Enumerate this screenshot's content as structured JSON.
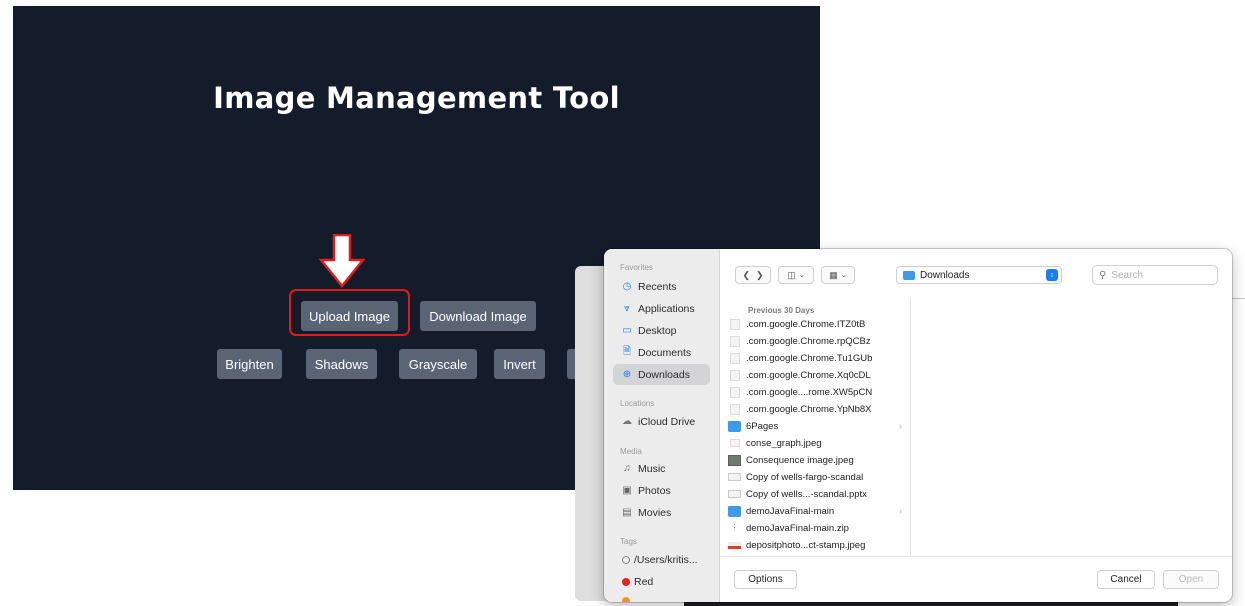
{
  "app": {
    "title": "Image Management Tool",
    "buttons": {
      "upload": "Upload Image",
      "download": "Download Image",
      "brighten": "Brighten",
      "shadows": "Shadows",
      "grayscale": "Grayscale",
      "invert": "Invert"
    }
  },
  "dialog": {
    "sidebar": {
      "favorites_header": "Favorites",
      "favorites": [
        "Recents",
        "Applications",
        "Desktop",
        "Documents",
        "Downloads"
      ],
      "selected": "Downloads",
      "locations_header": "Locations",
      "locations": [
        "iCloud Drive"
      ],
      "media_header": "Media",
      "media": [
        "Music",
        "Photos",
        "Movies"
      ],
      "tags_header": "Tags",
      "tags": [
        "/Users/kritis...",
        "Red"
      ]
    },
    "toolbar": {
      "location": "Downloads",
      "search_placeholder": "Search"
    },
    "list_header": "Previous 30 Days",
    "files": [
      ".com.google.Chrome.ITZ0tB",
      ".com.google.Chrome.rpQCBz",
      ".com.google.Chrome.Tu1GUb",
      ".com.google.Chrome.Xq0cDL",
      ".com.google....rome.XW5pCN",
      ".com.google.Chrome.YpNb8X",
      "6Pages",
      "conse_graph.jpeg",
      "Consequence image.jpeg",
      "Copy of wells-fargo-scandal",
      "Copy of wells...-scandal.pptx",
      "demoJavaFinal-main",
      "demoJavaFinal-main.zip",
      "depositphoto...ct-stamp.jpeg"
    ],
    "footer": {
      "options": "Options",
      "cancel": "Cancel",
      "open": "Open"
    }
  },
  "colors": {
    "app_bg": "#141b2b",
    "button_bg": "#5b6475",
    "highlight": "#e01b1b",
    "accent_blue": "#1c7cf2"
  }
}
